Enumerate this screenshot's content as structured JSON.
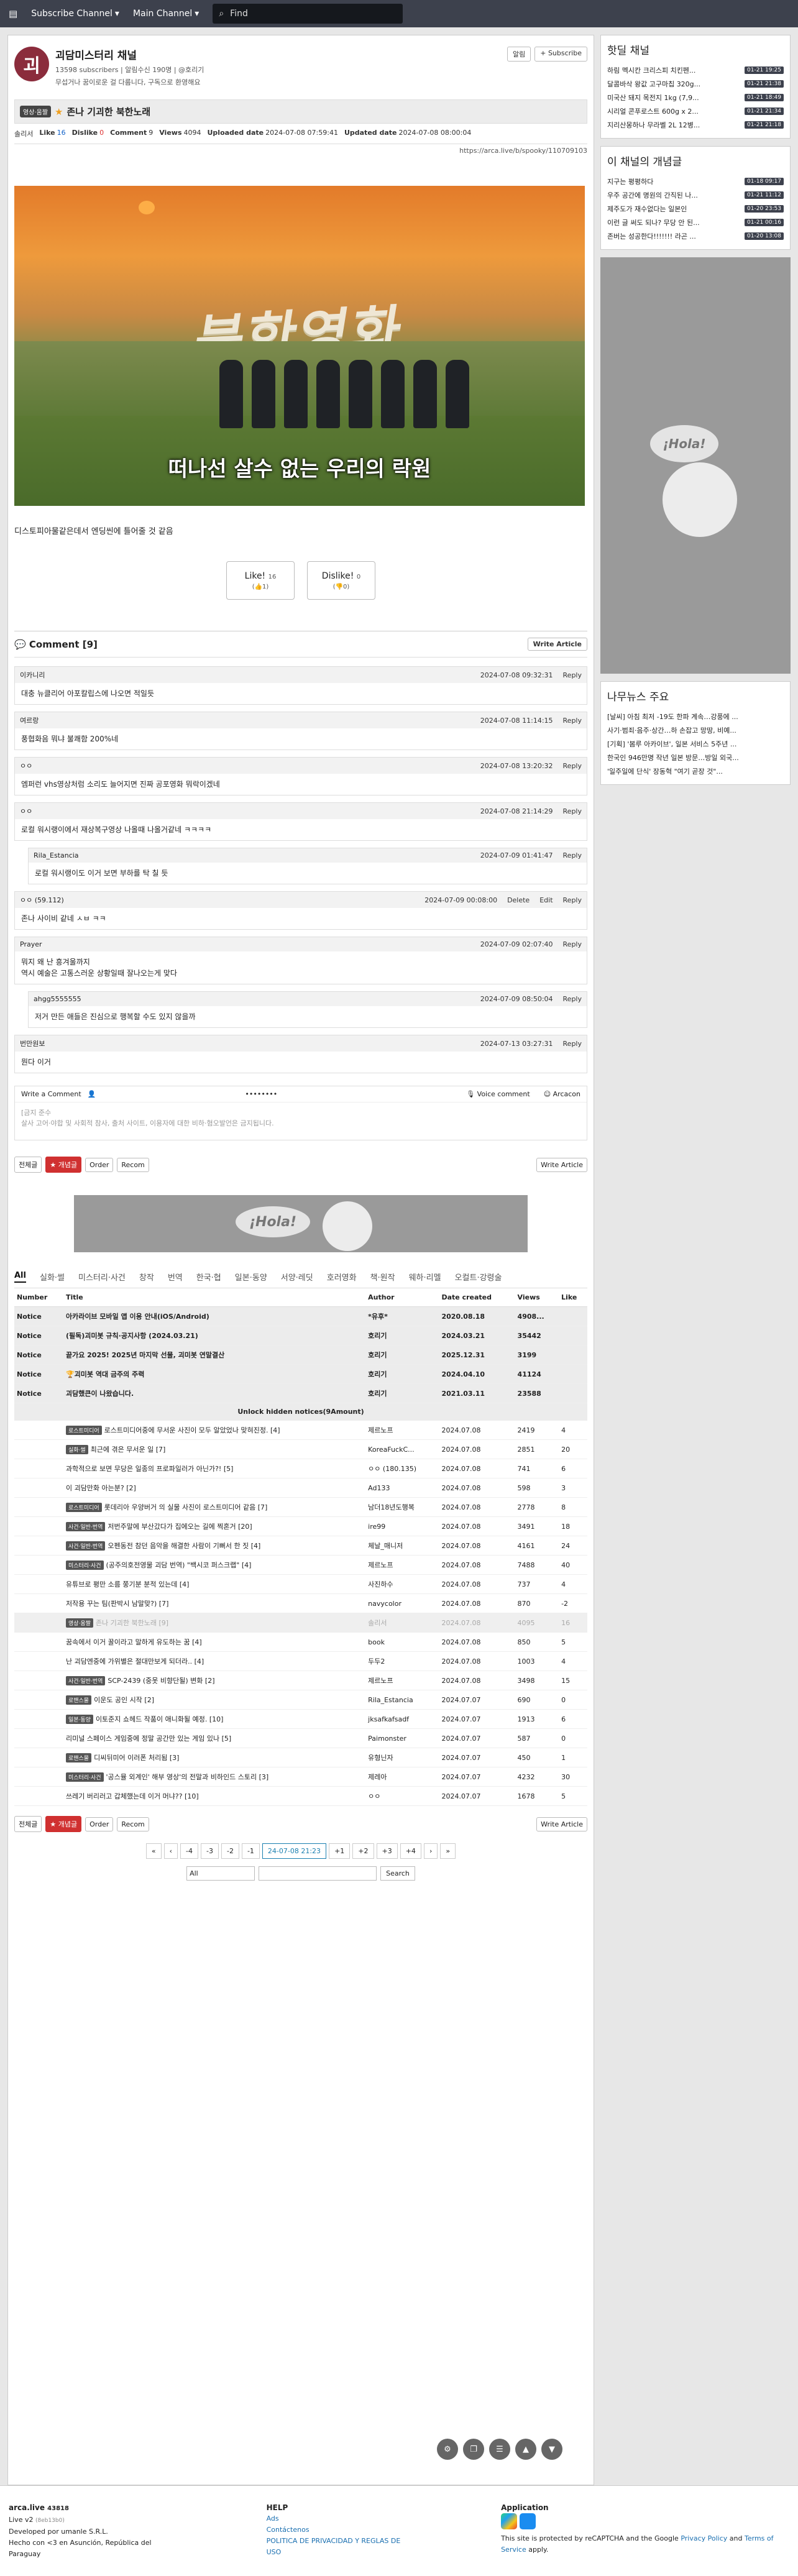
{
  "nav": {
    "subscribe": "Subscribe Channel",
    "main": "Main Channel",
    "search_placeholder": "Find"
  },
  "channel": {
    "name": "괴담미스터리 채널",
    "avatar": "괴",
    "subs": "13598 subscribers",
    "noti": "알림수신 190명",
    "manager": "@호리기",
    "desc": "무섭거나 꿈이로운 걸 다룹니다, 구독으로 환영해요",
    "alarm": "알림",
    "subscribe": "+ Subscribe"
  },
  "article": {
    "badge": "영상·움짤",
    "title": "존나 기괴한 북한노래",
    "author": "솔리서",
    "like_label": "Like",
    "like": "16",
    "dislike_label": "Dislike",
    "dislike": "0",
    "comment_label": "Comment",
    "comment": "9",
    "views_label": "Views",
    "views": "4094",
    "uploaded_label": "Uploaded date",
    "uploaded": "2024-07-08 07:59:41",
    "updated_label": "Updated date",
    "updated": "2024-07-08 08:00:04",
    "url": "https://arca.live/b/spooky/110709103",
    "video_letters": "북한영화",
    "caption": "떠나선 살수 없는 우리의 락원",
    "body": "디스토피아물같은데서 엔딩씬에 틀어줄 것 같음",
    "like_btn": "Like!",
    "like_count": "16",
    "like_sub": "(👍1)",
    "dislike_btn": "Dislike!",
    "dislike_count": "0",
    "dislike_sub": "(👎0)"
  },
  "comments": {
    "header": "Comment [9]",
    "write": "Write Article",
    "reply": "Reply",
    "delete": "Delete",
    "edit": "Edit",
    "items": [
      {
        "user": "이카니리",
        "date": "2024-07-08 09:32:31",
        "text": "대충 뉴클리어 아포칼립스에 나오면 적일듯",
        "reply": false
      },
      {
        "user": "여르랑",
        "date": "2024-07-08 11:14:15",
        "text": "풍협화음 뭐냐 불쾌함 200%네",
        "reply": false
      },
      {
        "user": "ㅇㅇ",
        "date": "2024-07-08 13:20:32",
        "text": "엠퍼런 vhs영상처럼 소리도 늘어지면 진짜 공포영화 뭐락이겠네",
        "reply": false
      },
      {
        "user": "ㅇㅇ",
        "date": "2024-07-08 21:14:29",
        "text": "로컬 워시랭이에서 재상복구영상 나올때 나올거같네 ㅋㅋㅋㅋ",
        "reply": false
      },
      {
        "user": "Rila_Estancia",
        "date": "2024-07-09 01:41:47",
        "text": "로컬 워시랭이도 이거 보면 부하를 탁 칠 듯",
        "reply": true
      },
      {
        "user": "ㅇㅇ (59.112)",
        "date": "2024-07-09 00:08:00",
        "text": "존나 사이비 같네 ㅅㅂ ㅋㅋ",
        "reply": false,
        "owner": true
      },
      {
        "user": "Prayer",
        "date": "2024-07-09 02:07:40",
        "text": "뭐지 왜 난 흥겨울까지\n역시 예술은 고통스러운 상황일때 잘나오는게 맞다",
        "reply": false
      },
      {
        "user": "ahgg5555555",
        "date": "2024-07-09 08:50:04",
        "text": "저거 만든 애들은 진심으로 행복할 수도 있지 않을까",
        "reply": true
      },
      {
        "user": "번만원보",
        "date": "2024-07-13 03:27:31",
        "text": "뭔다 이거",
        "reply": false
      }
    ]
  },
  "writebox": {
    "label": "Write a Comment",
    "dots": "••••••••",
    "voice": "Voice comment",
    "arcacon": "Arcacon",
    "placeholder": "[금지 준수\n살사 고어·야합 및 사회적 참사, 출처 사이트, 이용자에 대한 비하·혐오발언은 금지됩니다."
  },
  "toolbar": {
    "all": "전체글",
    "best": "★ 개념글",
    "order": "Order",
    "recom": "Recom",
    "write": "Write Article"
  },
  "ad": {
    "hola": "¡Hola!"
  },
  "cats": [
    "All",
    "실화·썰",
    "미스터리·사건",
    "창작",
    "번역",
    "한국·협",
    "일본·동양",
    "서양·레딧",
    "호러영화",
    "책·원작",
    "웨하·리멜",
    "오컬트·강령술"
  ],
  "list": {
    "headers": [
      "Number",
      "Title",
      "Author",
      "Date created",
      "Views",
      "Like"
    ],
    "notices": [
      {
        "n": "Notice",
        "t": "아카라이브 모바일 앱 이용 안내(iOS/Android)",
        "a": "*유후*",
        "d": "2020.08.18",
        "v": "4908...",
        "l": ""
      },
      {
        "n": "Notice",
        "t": "(필독)괴미봇 규칙·공지사항 (2024.03.21)",
        "a": "호리기",
        "d": "2024.03.21",
        "v": "35442",
        "l": ""
      },
      {
        "n": "Notice",
        "t": "끝가요 2025! 2025년 마지막 선물, 괴미봇 연말결산",
        "a": "호리기",
        "d": "2025.12.31",
        "v": "3199",
        "l": ""
      },
      {
        "n": "Notice",
        "t": "🏆괴미봇 역대 금주의 주력",
        "a": "호리기",
        "d": "2024.04.10",
        "v": "41124",
        "l": ""
      },
      {
        "n": "Notice",
        "t": "괴담했큰이 나왔습니다.",
        "a": "호리기",
        "d": "2021.03.11",
        "v": "23588",
        "l": ""
      }
    ],
    "unlock": "Unlock hidden notices(9Amount)",
    "rows": [
      {
        "tag": "로스트미디어",
        "t": "로스트미디어중에 무서운 사진이 모두 알았었나 맞혀진정. [4]",
        "a": "제르노프",
        "d": "2024.07.08",
        "v": "2419",
        "l": "4"
      },
      {
        "tag": "실화·썰",
        "t": "최근에 겪은 무서운 일 [7]",
        "a": "KoreaFuckC...",
        "d": "2024.07.08",
        "v": "2851",
        "l": "20"
      },
      {
        "tag": "",
        "t": "과학적으로 보면 무당은 일종의 프로파일러가 아닌가?! [5]",
        "a": "ㅇㅇ (180.135)",
        "d": "2024.07.08",
        "v": "741",
        "l": "6"
      },
      {
        "tag": "",
        "t": "이 괴담만화 아는분? [2]",
        "a": "Ad133",
        "d": "2024.07.08",
        "v": "598",
        "l": "3"
      },
      {
        "tag": "로스트미디어",
        "t": "롯데리아 우양버거 의 실물 사진이 로스트미디어 같음 [7]",
        "a": "남더18년도행복",
        "d": "2024.07.08",
        "v": "2778",
        "l": "8"
      },
      {
        "tag": "사건·일반·번역",
        "t": "저번주말에 부산갔다가 집에오는 길에 찍혼거 [20]",
        "a": "ire99",
        "d": "2024.07.08",
        "v": "3491",
        "l": "18"
      },
      {
        "tag": "사건·일반·번역",
        "t": "오펜동전 참던 음악을 해결한 사람이 기뻐서 한 짓 [4]",
        "a": "체날_매니저",
        "d": "2024.07.08",
        "v": "4161",
        "l": "24"
      },
      {
        "tag": "미스터리·사건",
        "t": "(공주의호전영물 괴담 번역) \"백시코 퍼스크랩\" [4]",
        "a": "제르노프",
        "d": "2024.07.08",
        "v": "7488",
        "l": "40"
      },
      {
        "tag": "",
        "t": "유튜브로 평만 소름 쭝기분 분적 있는데 [4]",
        "a": "사진하수",
        "d": "2024.07.08",
        "v": "737",
        "l": "4"
      },
      {
        "tag": "",
        "t": "저작용 꾸는 팀(판박시 남말맞?) [7]",
        "a": "navycolor",
        "d": "2024.07.08",
        "v": "870",
        "l": "-2"
      },
      {
        "tag": "영상·움짤",
        "t": "존나 기괴한 북한노래 [9]",
        "a": "솔리서",
        "d": "2024.07.08",
        "v": "4095",
        "l": "16",
        "cur": true
      },
      {
        "tag": "",
        "t": "꿈속에서 이거 꿀이라고 말하게 유도하는 꿈 [4]",
        "a": "book",
        "d": "2024.07.08",
        "v": "850",
        "l": "5"
      },
      {
        "tag": "",
        "t": "난 괴담엔중에 가위별은 절대만보게 되더라.. [4]",
        "a": "두두2",
        "d": "2024.07.08",
        "v": "1003",
        "l": "4"
      },
      {
        "tag": "사건·일반·번역",
        "t": "SCP-2439 (중못 비향단될) 변화 [2]",
        "a": "제르노프",
        "d": "2024.07.08",
        "v": "3498",
        "l": "15"
      },
      {
        "tag": "로맨스물",
        "t": "이운도 공인 시작 [2]",
        "a": "Rila_Estancia",
        "d": "2024.07.07",
        "v": "690",
        "l": "0"
      },
      {
        "tag": "일본·동양",
        "t": "이토준지 쇼헤드 작품이 애니화될 예정. [10]",
        "a": "jksafkafsadf",
        "d": "2024.07.07",
        "v": "1913",
        "l": "6"
      },
      {
        "tag": "",
        "t": "리미널 스페이스 게임중에 정말 공간만 있는 게임 있나 [5]",
        "a": "Paimonster",
        "d": "2024.07.07",
        "v": "587",
        "l": "0"
      },
      {
        "tag": "로맨스물",
        "t": "디씨뒤미어 이러폰 처리됨 [3]",
        "a": "유형닌자",
        "d": "2024.07.07",
        "v": "450",
        "l": "1"
      },
      {
        "tag": "미스터리·사건",
        "t": "'공스뮬 외계인' 해부 영상'의 전말과 비하인드 스토리 [3]",
        "a": "제레아",
        "d": "2024.07.07",
        "v": "4232",
        "l": "30"
      },
      {
        "tag": "",
        "t": "쓰레기 버리러고 갑체했는데 이거 머냐?? [10]",
        "a": "ㅇㅇ",
        "d": "2024.07.07",
        "v": "1678",
        "l": "5"
      }
    ]
  },
  "pager": [
    "«",
    "‹",
    "-4",
    "-3",
    "-2",
    "-1",
    "24-07-08 21:23",
    "+1",
    "+2",
    "+3",
    "+4",
    "›",
    "»"
  ],
  "search": {
    "scope": "All",
    "btn": "Search"
  },
  "side": {
    "hot_title": "핫딜 채널",
    "hot": [
      {
        "t": "하림 멕시칸 크리스피 치킨펜...",
        "time": "01-21 19:25"
      },
      {
        "t": "달콤바삭 왕값 고구마칩 320g...",
        "time": "01-21 21:38"
      },
      {
        "t": "미국산 돼지 목전지 1kg (7,9...",
        "time": "01-21 18:49"
      },
      {
        "t": "시리얼 콘푸로스트 600g x 2...",
        "time": "01-21 21:34"
      },
      {
        "t": "지리산몽하나 무라벨 2L 12병...",
        "time": "01-21 21:18"
      }
    ],
    "best_title": "이 채널의 개념글",
    "best": [
      {
        "t": "지구는 평평하다",
        "time": "01-18 09:17"
      },
      {
        "t": "우주 공간에 명원의 간직된 나...",
        "time": "01-21 11:12"
      },
      {
        "t": "제주도가 재수없다는 일본인",
        "time": "01-20 23:53"
      },
      {
        "t": "이런 글 써도 되나? 무당 안 된...",
        "time": "01-21 00:16"
      },
      {
        "t": "존버는 성공한다!!!!!!! 라곤 ...",
        "time": "01-20 13:08"
      }
    ],
    "news_title": "나무뉴스 주요",
    "news": [
      "[날씨] 아침 최저 -19도 한파 계속…강풍에 ...",
      "사기·범죄·음주·상간…하 손잡고 망땅, 비예...",
      "[기획] '봄루 아카이브', 일본 서비스 5주년 ...",
      "한국인 946만명 작년 일본 방문…방일 외국...",
      "'일주일에 단식' 장동혁 \"여기 곧장 것\"..."
    ]
  },
  "footer": {
    "brand": "arca.live",
    "count": "43818",
    "ver": "Live v2",
    "ver_sub": "(8eb13b0)",
    "dev": "Developed por umanle S.R.L.",
    "made": "Hecho con <3 en Asunción, República del Paraguay",
    "help": "HELP",
    "ads": "Ads",
    "contact": "Contáctenos",
    "policy": "POLITICA DE PRIVACIDAD Y REGLAS DE USO",
    "app": "Application",
    "recaptcha1": "This site is protected by reCAPTCHA and the Google",
    "privacy": "Privacy Policy",
    "and": "and",
    "terms": "Terms of Service",
    "apply": "apply."
  },
  "colors": {
    "nav": "#3d414d",
    "accent": "#1a7fb0",
    "best": "#d03030"
  }
}
